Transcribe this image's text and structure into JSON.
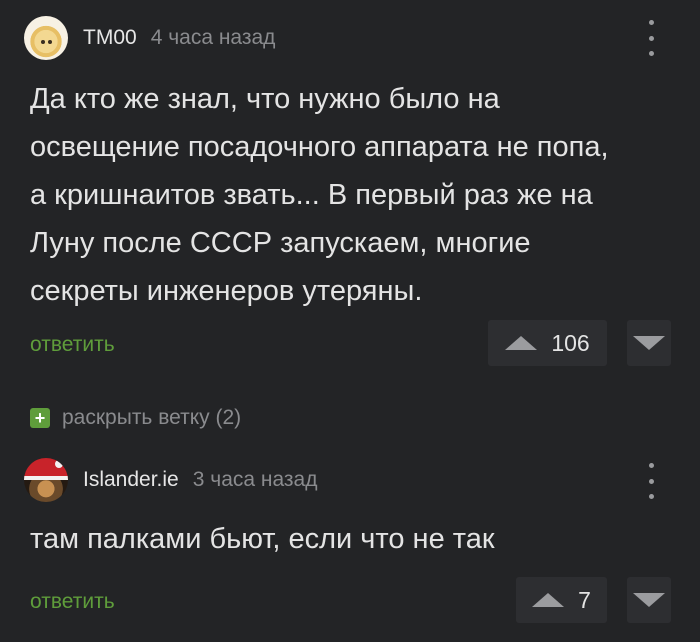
{
  "comments": [
    {
      "user": "TM00",
      "time": "4 часа назад",
      "text": "Да кто же знал, что нужно было на\nосвещение посадочного аппарата не попа,\nа кришнаитов звать... В первый раз же на\nЛуну после СССР запускаем, многие\nсекреты инженеров утеряны.",
      "reply_label": "ответить",
      "rating": "106"
    },
    {
      "user": "Islander.ie",
      "time": "3 часа назад",
      "text": "там палками бьют, если что не так",
      "reply_label": "ответить",
      "rating": "7"
    }
  ],
  "thread": {
    "expand_icon": "+",
    "expand_label": "раскрыть ветку (2)"
  },
  "colors": {
    "background": "#232426",
    "accent_green": "#5f9d3b",
    "muted": "#8a8b8e"
  },
  "icons": [
    "avatar",
    "more-vertical-icon",
    "upvote-icon",
    "downvote-icon",
    "plus-icon"
  ]
}
